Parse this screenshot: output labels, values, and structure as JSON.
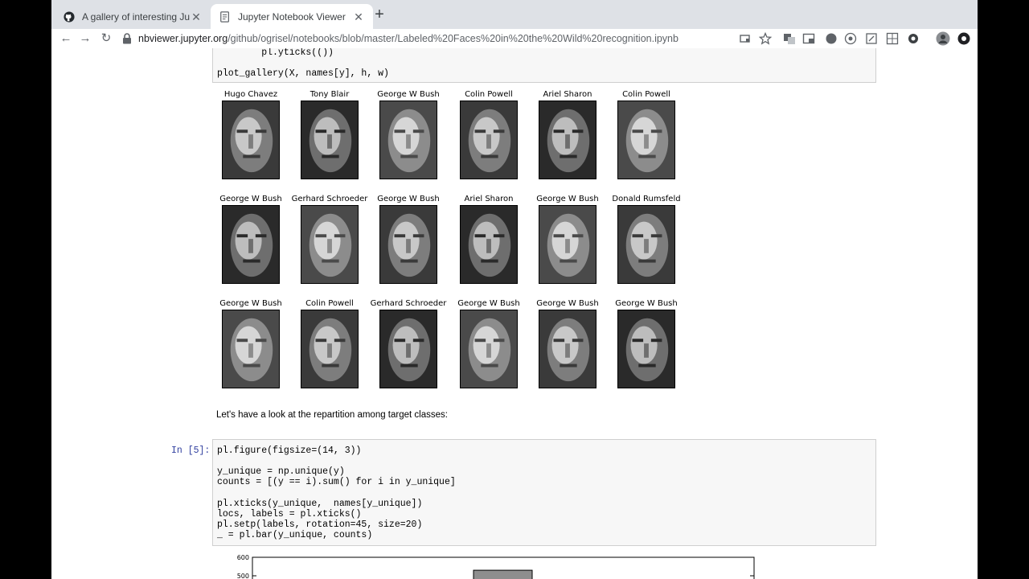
{
  "tabs": [
    {
      "title": "A gallery of interesting Jupyter",
      "icon": "github-icon"
    },
    {
      "title": "Jupyter Notebook Viewer",
      "icon": "jupyter-icon"
    }
  ],
  "url": {
    "host": "nbviewer.jupyter.org",
    "path": "/github/ogrisel/notebooks/blob/master/Labeled%20Faces%20in%20the%20Wild%20recognition.ipynb"
  },
  "cell_prev": {
    "lines": [
      "        pl.yticks(())",
      "",
      "plot_gallery(X, names[y], h, w)"
    ]
  },
  "gallery": {
    "rows": [
      [
        "Hugo Chavez",
        "Tony Blair",
        "George W Bush",
        "Colin Powell",
        "Ariel Sharon",
        "Colin Powell"
      ],
      [
        "George W Bush",
        "Gerhard Schroeder",
        "George W Bush",
        "Ariel Sharon",
        "George W Bush",
        "Donald Rumsfeld"
      ],
      [
        "George W Bush",
        "Colin Powell",
        "Gerhard Schroeder",
        "George W Bush",
        "George W Bush",
        "George W Bush"
      ]
    ]
  },
  "markdown": {
    "text": "Let's have a look at the repartition among target classes:"
  },
  "cell5": {
    "prompt": "In [5]:",
    "lines": [
      "pl.figure(figsize=(14, 3))",
      "",
      "y_unique = np.unique(y)",
      "counts = [(y == i).sum() for i in y_unique]",
      "",
      "pl.xticks(y_unique,  names[y_unique])",
      "locs, labels = pl.xticks()",
      "pl.setp(labels, rotation=45, size=20)",
      "_ = pl.bar(y_unique, counts)"
    ]
  },
  "chart_data": {
    "type": "bar",
    "ytick_labels": [
      "600",
      "500"
    ],
    "ylim": [
      0,
      600
    ],
    "visible_values": [
      530
    ]
  }
}
